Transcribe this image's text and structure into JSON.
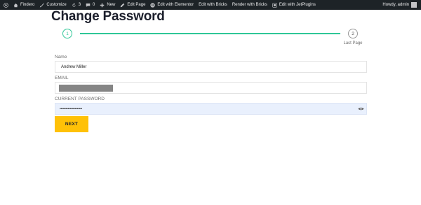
{
  "adminbar": {
    "items": [
      {
        "label": "",
        "icon": "wordpress-icon"
      },
      {
        "label": "Findero",
        "icon": "house-icon"
      },
      {
        "label": "Customize",
        "icon": "brush-icon"
      },
      {
        "label": "3",
        "icon": "refresh-icon"
      },
      {
        "label": "0",
        "icon": "comment-icon"
      },
      {
        "label": "New",
        "icon": "plus-icon"
      },
      {
        "label": "Edit Page",
        "icon": "pencil-icon"
      },
      {
        "label": "Edit with Elementor",
        "icon": "elementor-icon"
      },
      {
        "label": "Edit with Bricks",
        "icon": ""
      },
      {
        "label": "Render with Bricks",
        "icon": ""
      },
      {
        "label": "Edit with JetPlugins",
        "icon": "jetplugins-icon"
      }
    ],
    "greeting": "Howdy, admin"
  },
  "page": {
    "title": "Change Password"
  },
  "steps": {
    "step1": "1",
    "step2": "2",
    "step2_label": "Last Page"
  },
  "form": {
    "name_label": "Name",
    "name_value": "Andrew Miller",
    "email_label": "EMAIL",
    "password_label": "CURRENT PASSWORD",
    "password_value": "••••••••••••••••••••••",
    "next_label": "NEXT"
  },
  "colors": {
    "adminbar_bg": "#1d2327",
    "progress": "#2fc797",
    "button": "#ffc107",
    "autofill": "#e9f0fd"
  }
}
